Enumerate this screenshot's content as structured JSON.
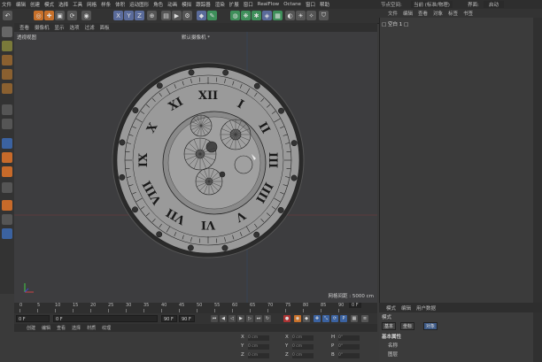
{
  "menubar": [
    "文件",
    "编辑",
    "创建",
    "模式",
    "选择",
    "工具",
    "网格",
    "样条",
    "体积",
    "运动图形",
    "角色",
    "动画",
    "模拟",
    "跟踪器",
    "渲染",
    "扩展",
    "窗口",
    "RealFlow",
    "Octane",
    "窗口",
    "帮助"
  ],
  "toolbar_icons": [
    "undo-icon",
    "select-icon",
    "move-icon",
    "scale-icon",
    "rotate-icon",
    "axis-x",
    "axis-y",
    "axis-z",
    "coord-icon",
    "render-region-icon",
    "render-view-icon",
    "render-settings-icon",
    "cube-icon",
    "pen-icon",
    "subdivision-icon",
    "array-icon",
    "deformer-icon",
    "floor-icon",
    "camera-icon",
    "light-icon",
    "tag-icon"
  ],
  "toolbar_axes": [
    "X",
    "Y",
    "Z"
  ],
  "viewport": {
    "menu": [
      "查看",
      "摄像机",
      "显示",
      "选项",
      "过滤",
      "面板"
    ],
    "label": "透视视图",
    "camera": "默认摄像机 *",
    "grid_spacing": "网格间距 : 5000 cm",
    "clock_numerals": [
      "XII",
      "I",
      "II",
      "III",
      "IIII",
      "V",
      "VI",
      "VII",
      "VIII",
      "IX",
      "X",
      "XI"
    ]
  },
  "timeline": {
    "ticks": [
      "0",
      "5",
      "10",
      "15",
      "20",
      "25",
      "30",
      "35",
      "40",
      "45",
      "50",
      "55",
      "60",
      "65",
      "70",
      "75",
      "80",
      "85",
      "90"
    ],
    "frame_display": "0 F"
  },
  "transport": {
    "start": "0 F",
    "current": "0 F",
    "end": "90 F",
    "end2": "90 F"
  },
  "material_menu": [
    "创建",
    "编辑",
    "查看",
    "选择",
    "材质",
    "纹理"
  ],
  "coords": {
    "rows": [
      {
        "axis": "X",
        "pos": "0 cm",
        "axis2": "X",
        "size": "0 cm",
        "axis3": "H",
        "rot": "0°"
      },
      {
        "axis": "Y",
        "pos": "0 cm",
        "axis2": "Y",
        "size": "0 cm",
        "axis3": "P",
        "rot": "0°"
      },
      {
        "axis": "Z",
        "pos": "0 cm",
        "axis2": "Z",
        "size": "0 cm",
        "axis3": "B",
        "rot": "0°"
      }
    ]
  },
  "right_panel": {
    "top_label": "节点空间:",
    "top_value": "当前 (标准/物理)",
    "layout_label": "界面:",
    "layout_value": "启动",
    "menu": [
      "文件",
      "编辑",
      "查看",
      "对象",
      "标签",
      "书签"
    ],
    "object_row": "□ 空白 1 □",
    "attr_tabs": [
      "模式",
      "编辑",
      "用户数据"
    ],
    "attr_title": "模式",
    "attr_subtabs": [
      "基本",
      "坐标",
      "对象"
    ],
    "attr_section": "基本属性",
    "attr_fields": [
      "名称",
      "图层"
    ]
  }
}
